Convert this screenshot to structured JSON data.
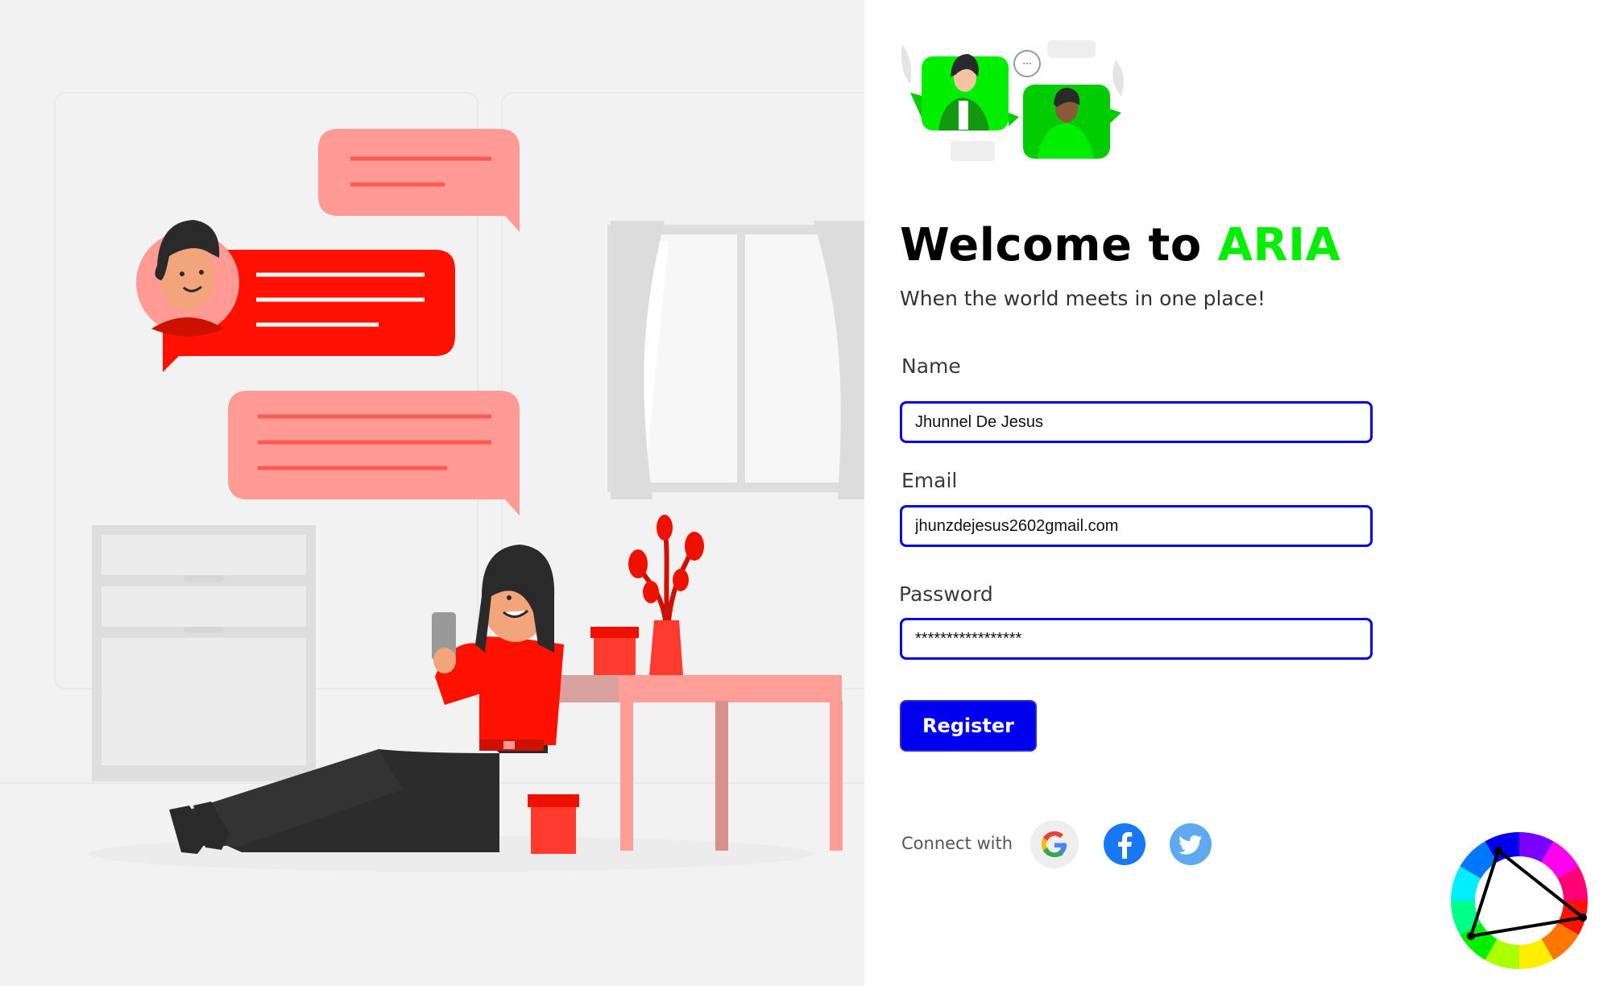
{
  "welcome": {
    "prefix": "Welcome to ",
    "brand": "ARIA",
    "subtitle": "When the world meets in one place!"
  },
  "form": {
    "name": {
      "label": "Name",
      "value": "Jhunnel De Jesus"
    },
    "email": {
      "label": "Email",
      "value": "jhunzdejesus2602gmail.com"
    },
    "password": {
      "label": "Password",
      "value": "*****************"
    },
    "register_label": "Register"
  },
  "social": {
    "connect_label": "Connect with",
    "providers": [
      {
        "name": "Google",
        "icon": "google-icon"
      },
      {
        "name": "Facebook",
        "icon": "facebook-icon"
      },
      {
        "name": "Twitter",
        "icon": "twitter-icon"
      }
    ]
  },
  "icons": {
    "header_illustration": "video-chat-illustration",
    "hero_illustration": "woman-chatting-illustration",
    "corner": "color-wheel-icon"
  },
  "colors": {
    "brand_green": "#00ee00",
    "primary_blue": "#0000ee",
    "chat_red": "#ff1100",
    "chat_pink": "#ff9a94",
    "panel_grey": "#f2f2f2"
  }
}
